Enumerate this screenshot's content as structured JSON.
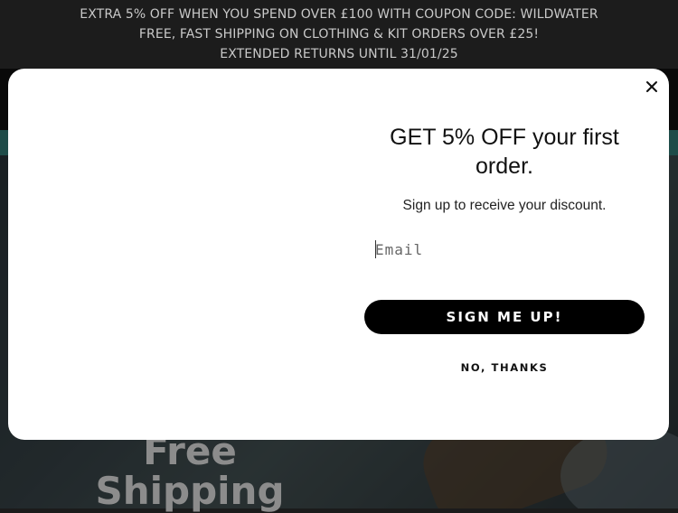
{
  "announcement": {
    "lines": [
      "EXTRA 5% OFF WHEN YOU SPEND OVER £100 WITH COUPON CODE: WILDWATER",
      "FREE, FAST SHIPPING ON CLOTHING & KIT ORDERS OVER £25!",
      "EXTENDED RETURNS UNTIL 31/01/25"
    ]
  },
  "hero": {
    "line1": "Free",
    "line2": "Shipping"
  },
  "popup": {
    "title": "GET 5% OFF your first order.",
    "subtitle": "Sign up to receive your discount.",
    "email_placeholder": "Email",
    "email_value": "",
    "submit_label": "SIGN ME UP!",
    "decline_label": "NO, THANKS",
    "close_icon": "close-icon"
  },
  "colors": {
    "announcement_bg": "#1c1c1c",
    "teal_strip": "#3a8a86",
    "button_bg": "#000000",
    "modal_bg": "#ffffff"
  }
}
